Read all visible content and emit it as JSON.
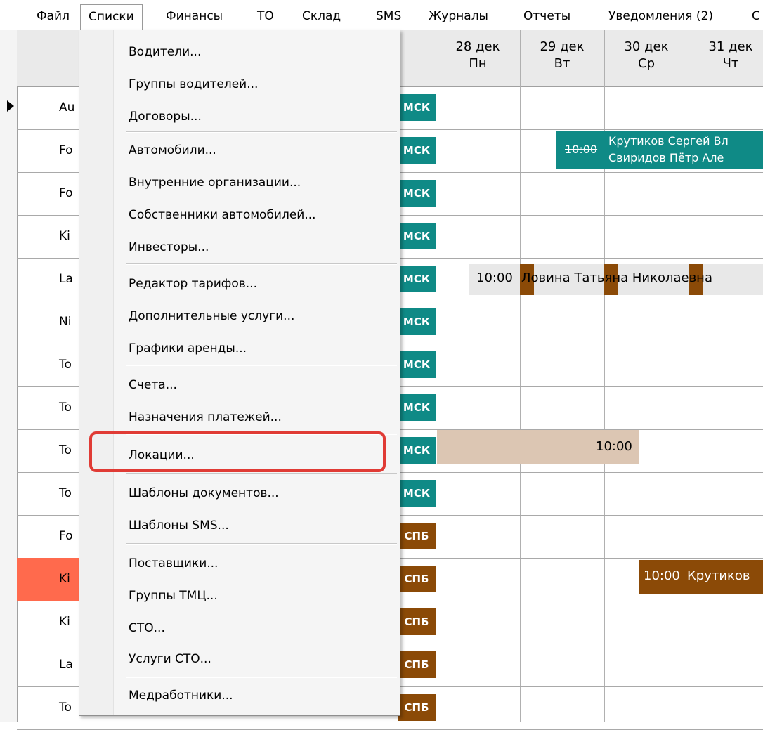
{
  "menubar": {
    "items": [
      "Файл",
      "Списки",
      "Финансы",
      "ТО",
      "Склад",
      "SMS",
      "Журналы",
      "Отчеты",
      "Уведомления (2)",
      "С"
    ]
  },
  "grid": {
    "days": [
      {
        "date": "28 дек",
        "weekday": "Пн"
      },
      {
        "date": "29 дек",
        "weekday": "Вт"
      },
      {
        "date": "30 дек",
        "weekday": "Ср"
      },
      {
        "date": "31 дек",
        "weekday": "Чт"
      }
    ],
    "rows": [
      {
        "name": "Au",
        "loc": "МСК"
      },
      {
        "name": "Fo",
        "loc": "МСК"
      },
      {
        "name": "Fo",
        "loc": "МСК"
      },
      {
        "name": "Ki",
        "loc": "МСК"
      },
      {
        "name": "La",
        "loc": "МСК"
      },
      {
        "name": "Ni",
        "loc": "МСК"
      },
      {
        "name": "To",
        "loc": "МСК"
      },
      {
        "name": "To",
        "loc": "МСК"
      },
      {
        "name": "To",
        "loc": "МСК"
      },
      {
        "name": "To",
        "loc": "МСК"
      },
      {
        "name": "Fo",
        "loc": "СПБ"
      },
      {
        "name": "Ki",
        "loc": "СПБ"
      },
      {
        "name": "Ki",
        "loc": "СПБ"
      },
      {
        "name": "La",
        "loc": "СПБ"
      },
      {
        "name": "To",
        "loc": "СПБ"
      }
    ],
    "events": {
      "row2_time": "10:00",
      "row2_line1": "Крутиков Сергей Вл",
      "row2_line2": "Свиридов Пётр Але",
      "row5_time": "10:00",
      "row5_text": "Ловина Татьяна Николаевна",
      "row9_time": "10:00",
      "row12_time": "10:00",
      "row12_text": "Крутиков"
    }
  },
  "dropdown": {
    "items": [
      "Водители...",
      "Группы водителей...",
      "Договоры...",
      "Автомобили...",
      "Внутренние организации...",
      "Собственники автомобилей...",
      "Инвесторы...",
      "Редактор тарифов...",
      "Дополнительные услуги...",
      "Графики аренды...",
      "Счета...",
      "Назначения платежей...",
      "Локации...",
      "Шаблоны документов...",
      "Шаблоны SMS...",
      "Поставщики...",
      "Группы ТМЦ...",
      "СТО...",
      "Услуги СТО...",
      "Медработники..."
    ]
  },
  "colors": {
    "msk": "#0f8a86",
    "spb": "#8b4a07",
    "selected_row": "#ff6a4d",
    "highlight": "#e03b35"
  }
}
